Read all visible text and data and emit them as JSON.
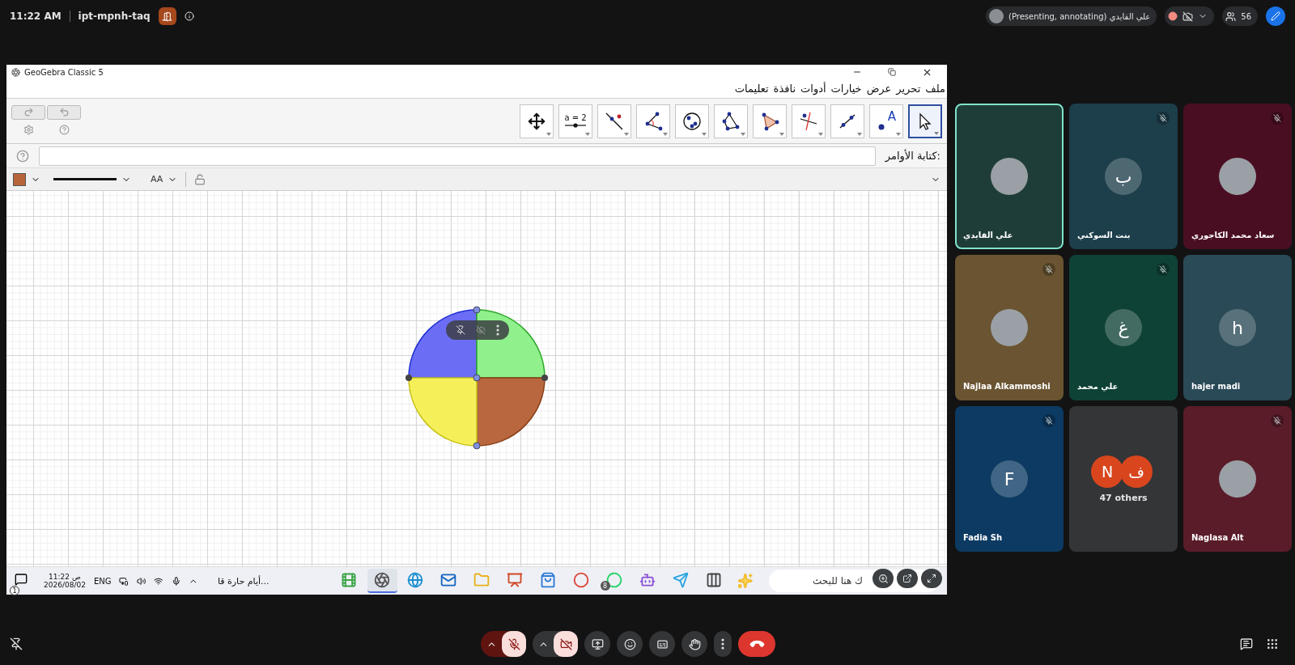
{
  "meeting_bar": {
    "time": "11:22 AM",
    "code": "ipt-mpnh-taq",
    "presenter": "علي القايدي (Presenting, annotating)",
    "participant_count": "56"
  },
  "app_window": {
    "title": "GeoGebra Classic 5",
    "menu": [
      "ملف",
      "تحرير",
      "عرض",
      "خيارات",
      "أدوات",
      "نافذة",
      "تعليمات"
    ],
    "tools": [
      {
        "kind": "pointer",
        "selected": true
      },
      {
        "kind": "point",
        "label": "A",
        "selected": false
      },
      {
        "kind": "segment",
        "selected": false
      },
      {
        "kind": "perpendicular",
        "selected": false
      },
      {
        "kind": "triangle",
        "selected": false
      },
      {
        "kind": "polygon",
        "selected": false
      },
      {
        "kind": "circle",
        "selected": false
      },
      {
        "kind": "angle",
        "selected": false
      },
      {
        "kind": "line-point",
        "selected": false
      },
      {
        "kind": "slider",
        "label": "a = 2",
        "selected": false
      },
      {
        "kind": "move-view",
        "selected": false
      }
    ],
    "input_label": "كتابة الأوامر:",
    "text_size_label": "AA"
  },
  "taskbar": {
    "notification_count": "1",
    "time": "11:22 ص",
    "date": "2026/08/02",
    "language": "ENG",
    "weather": "أيام حارة قا...",
    "apps": [
      {
        "kind": "camtasia",
        "selected": false
      },
      {
        "kind": "geogebra",
        "selected": true
      },
      {
        "kind": "edge",
        "selected": false
      },
      {
        "kind": "outlook",
        "selected": false
      },
      {
        "kind": "explorer",
        "selected": false
      },
      {
        "kind": "powerpoint",
        "selected": false
      },
      {
        "kind": "store",
        "selected": false
      },
      {
        "kind": "chrome",
        "selected": false
      },
      {
        "kind": "whatsapp",
        "badge": "8",
        "selected": false
      },
      {
        "kind": "copilot",
        "selected": false
      },
      {
        "kind": "telegram",
        "selected": false
      },
      {
        "kind": "snip",
        "selected": false
      }
    ],
    "search": "ك هنا للبحث"
  },
  "participants": [
    {
      "kind": "photo",
      "name": "سعاد محمد الكاجوري",
      "color": "#4a0e22",
      "muted": true,
      "speaking": false
    },
    {
      "kind": "letter",
      "initial": "ب",
      "name": "بنت السوكني",
      "color": "#1d3e4b",
      "muted": true,
      "speaking": false
    },
    {
      "kind": "photo",
      "name": "علي القايدي",
      "color": "#1f3d38",
      "muted": false,
      "speaking": true
    },
    {
      "kind": "letter",
      "initial": "h",
      "name": "hajer madi",
      "color": "#2a4a57",
      "muted": false,
      "speaking": false
    },
    {
      "kind": "letter",
      "initial": "غ",
      "name": "علي محمد",
      "color": "#0f4236",
      "muted": true,
      "speaking": false
    },
    {
      "kind": "photo",
      "name": "Najlaa Alkammoshi",
      "color": "#6a5431",
      "muted": true,
      "speaking": false
    },
    {
      "kind": "photo",
      "name": "Naglasa Alt",
      "color": "#5a1c29",
      "muted": true,
      "speaking": false
    },
    {
      "kind": "others",
      "initials": [
        "ف",
        "N"
      ],
      "label": "47 others",
      "color": "#333537"
    },
    {
      "kind": "letter",
      "initial": "F",
      "name": "Fadia Sh",
      "color": "#0c3a62",
      "muted": true,
      "speaking": false
    }
  ]
}
